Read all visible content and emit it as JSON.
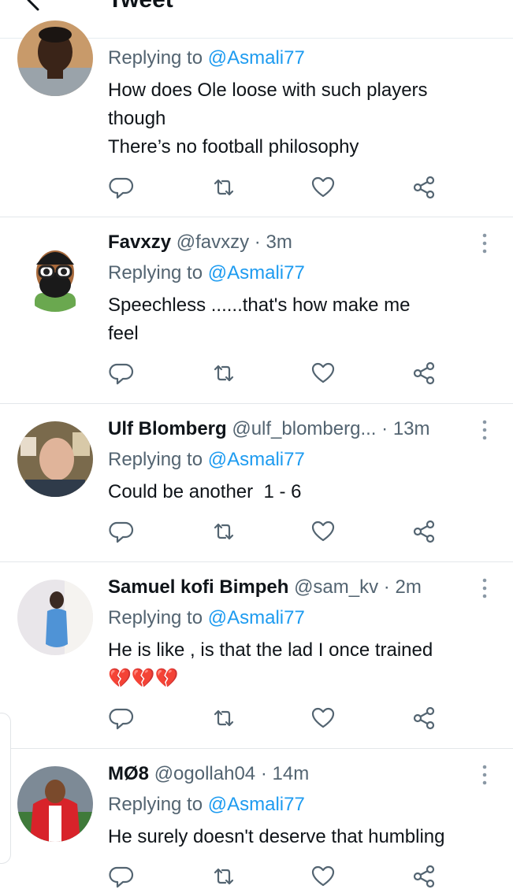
{
  "header": {
    "title": "Tweet"
  },
  "replying_prefix": "Replying to",
  "tweets": [
    {
      "name": "",
      "handle": "",
      "time": "",
      "reply_to": "@Asmali77",
      "lines": [
        "How does Ole loose with such players",
        "though",
        "There’s no football philosophy"
      ]
    },
    {
      "name": "Favxzy",
      "handle": "@favxzy",
      "time": "3m",
      "reply_to": "@Asmali77",
      "lines": [
        "Speechless ......that's how make me",
        "feel"
      ]
    },
    {
      "name": "Ulf Blomberg",
      "handle": "@ulf_blomberg...",
      "time": "13m",
      "reply_to": "@Asmali77",
      "lines": [
        "Could be another  1 - 6"
      ]
    },
    {
      "name": "Samuel kofi Bimpeh",
      "handle": "@sam_kv",
      "time": "2m",
      "reply_to": "@Asmali77",
      "lines": [
        "He is like , is that the lad I once trained"
      ],
      "emoji": "💔💔💔"
    },
    {
      "name": "MØ8",
      "handle": "@ogollah04",
      "time": "14m",
      "reply_to": "@Asmali77",
      "lines": [
        "He surely doesn't deserve that humbling"
      ]
    }
  ],
  "colors": {
    "link": "#1d9bf0",
    "secondary_text": "#536471",
    "heart_emoji": "#e0245e"
  },
  "icons": [
    "back-arrow-icon",
    "reply-icon",
    "retweet-icon",
    "like-icon",
    "share-icon",
    "more-icon",
    "broken-heart-icon"
  ]
}
